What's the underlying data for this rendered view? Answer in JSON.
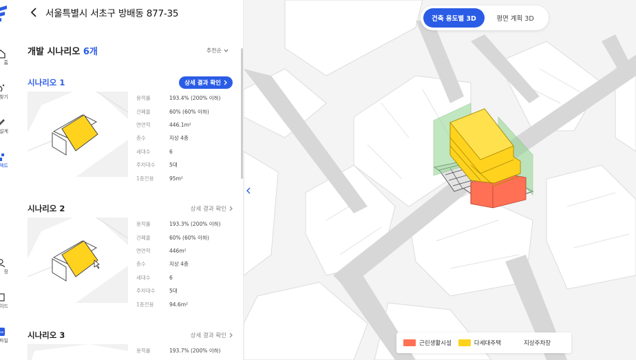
{
  "address": "서울특별시 서초구 방배동 877-35",
  "rail": {
    "items": [
      {
        "label": "홈",
        "icon": "home-icon"
      },
      {
        "label": "찾기",
        "icon": "search-sparkle-icon"
      },
      {
        "label": "설계",
        "icon": "pencil-icon"
      },
      {
        "label": "젝트",
        "icon": "project-icon"
      },
      {
        "label": "정",
        "icon": "user-icon"
      },
      {
        "label": "이드",
        "icon": "book-icon"
      },
      {
        "label": "파일",
        "icon": "file-icon"
      }
    ]
  },
  "scenarios": {
    "title": "개발 시나리오",
    "count": "6개",
    "sort": "추천순",
    "items": [
      {
        "title": "시나리오 1",
        "detail": "상세 결과 확인",
        "props": [
          {
            "k": "용적률",
            "v": "193.4% (200% 이하)"
          },
          {
            "k": "건폐율",
            "v": "60% (60% 이하)"
          },
          {
            "k": "연면적",
            "v": "446.1m²"
          },
          {
            "k": "층수",
            "v": "지상 4층"
          },
          {
            "k": "세대수",
            "v": "6"
          },
          {
            "k": "주차대수",
            "v": "5대"
          },
          {
            "k": "1층전용",
            "v": "95m²"
          }
        ]
      },
      {
        "title": "시나리오 2",
        "detail": "상세 결과 확인",
        "props": [
          {
            "k": "용적률",
            "v": "193.3% (200% 이하)"
          },
          {
            "k": "건폐율",
            "v": "60% (60% 이하)"
          },
          {
            "k": "연면적",
            "v": "446m²"
          },
          {
            "k": "층수",
            "v": "지상 4층"
          },
          {
            "k": "세대수",
            "v": "6"
          },
          {
            "k": "주차대수",
            "v": "5대"
          },
          {
            "k": "1층전용",
            "v": "94.6m²"
          }
        ]
      },
      {
        "title": "시나리오 3",
        "detail": "상세 결과 확인",
        "props": [
          {
            "k": "용적률",
            "v": "193.7% (200% 이하)"
          }
        ]
      }
    ]
  },
  "view_toggle": {
    "options": [
      "건축 용도별 3D",
      "평면 계획 3D"
    ],
    "selected": "건축 용도별 3D"
  },
  "legend": [
    {
      "label": "근린생활시설",
      "color": "#ff7055"
    },
    {
      "label": "다세대주택",
      "color": "#ffd21e"
    },
    {
      "label": "지상주차장",
      "color": "#ffffff"
    }
  ],
  "colors": {
    "accent": "#2b5ce6",
    "commercial": "#ff7055",
    "residential": "#ffd21e",
    "setback": "#8fd58f"
  }
}
